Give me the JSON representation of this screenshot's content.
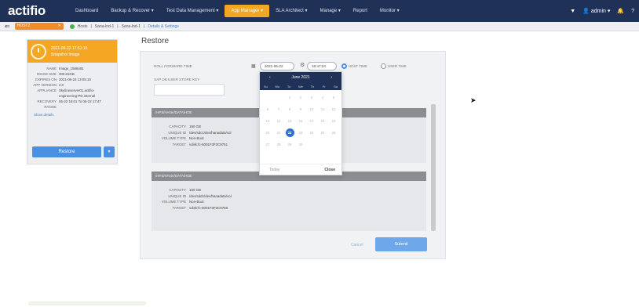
{
  "app": {
    "logo": "actifio"
  },
  "nav": {
    "items": [
      "Dashboard",
      "Backup & Recover ▾",
      "Test Data Management ▾",
      "App Manager ▾",
      "SLA Architect ▾",
      "Manage ▾",
      "Report",
      "Monitor ▾"
    ],
    "active_index": 3
  },
  "top_right": {
    "user": "admin"
  },
  "subbar": {
    "host": "HOST2",
    "crumbs": [
      "Hosts",
      "Sana-lnd-1",
      "Sana-lnd-1",
      "Details & Settings"
    ]
  },
  "image_card": {
    "timestamp": "2021-06-22 17:51:15",
    "subtitle": "Snapshot Image",
    "rows": [
      {
        "label": "NAME",
        "value": "Image_1586481"
      },
      {
        "label": "IMAGE SIZE",
        "value": "300.81GB"
      },
      {
        "label": "EXPIRES ON",
        "value": "2021-06-24 13:05:19"
      },
      {
        "label": "APP VERSION",
        "value": "2.0"
      },
      {
        "label": "APPLIANCE",
        "value": "Skylineserver01.actifio-\nengineering-PD.internal"
      },
      {
        "label": "RECOVERY\nRANGE",
        "value": "06-22 15:01 To 06-22 17:47"
      }
    ],
    "more_details": "Show details",
    "restore_label": "Restore",
    "restore_caret": "▾"
  },
  "restore": {
    "title": "Restore",
    "roll_forward_label": "ROLL FORWARD TIME",
    "date_value": "2021-06-22",
    "time_value": "18:47:24",
    "host_time_label": "HOST TIME",
    "user_time_label": "USER TIME",
    "sap_key_label": "SAP DB USER STORE KEY",
    "sap_key_value": "",
    "cancel_label": "Cancel",
    "submit_label": "Submit"
  },
  "volumes": [
    {
      "header": "/HPS/HANA/DATA/HDE",
      "rows": [
        {
          "label": "CAPACITY",
          "value": "150 GB"
        },
        {
          "label": "UNIQUE ID",
          "value": "/dev/sdc1/dev/hanadata/vol"
        },
        {
          "label": "VOLUME TYPE",
          "value": "Non-Boot"
        },
        {
          "label": "TARGET",
          "value": "vdisk:fc-6001F3F3C9751"
        }
      ]
    },
    {
      "header": "/HPS/HANA/DATA/HDE",
      "rows": [
        {
          "label": "CAPACITY",
          "value": "150 GB"
        },
        {
          "label": "UNIQUE ID",
          "value": "/dev/sdd1/dev/hanadata/vol"
        },
        {
          "label": "VOLUME TYPE",
          "value": "Non-Boot"
        },
        {
          "label": "TARGET",
          "value": "vdisk:fc-6001F3F3C9758"
        }
      ]
    }
  ],
  "calendar": {
    "month_label": "June 2021",
    "prev": "‹",
    "next": "›",
    "weekdays": [
      "Su",
      "Mo",
      "Tu",
      "We",
      "Th",
      "Fr",
      "Sa"
    ],
    "days": [
      "",
      "",
      "1",
      "2",
      "3",
      "4",
      "5",
      "6",
      "7",
      "8",
      "9",
      "10",
      "11",
      "12",
      "13",
      "14",
      "15",
      "16",
      "17",
      "18",
      "19",
      "20",
      "21",
      "22",
      "23",
      "24",
      "25",
      "26",
      "27",
      "28",
      "29",
      "30",
      "",
      "",
      ""
    ],
    "selected_day": "22",
    "today_label": "Today",
    "close_label": "Close"
  },
  "colors": {
    "topbar": "#1f3157",
    "accent": "#f5a623",
    "primary": "#4a90e2"
  }
}
